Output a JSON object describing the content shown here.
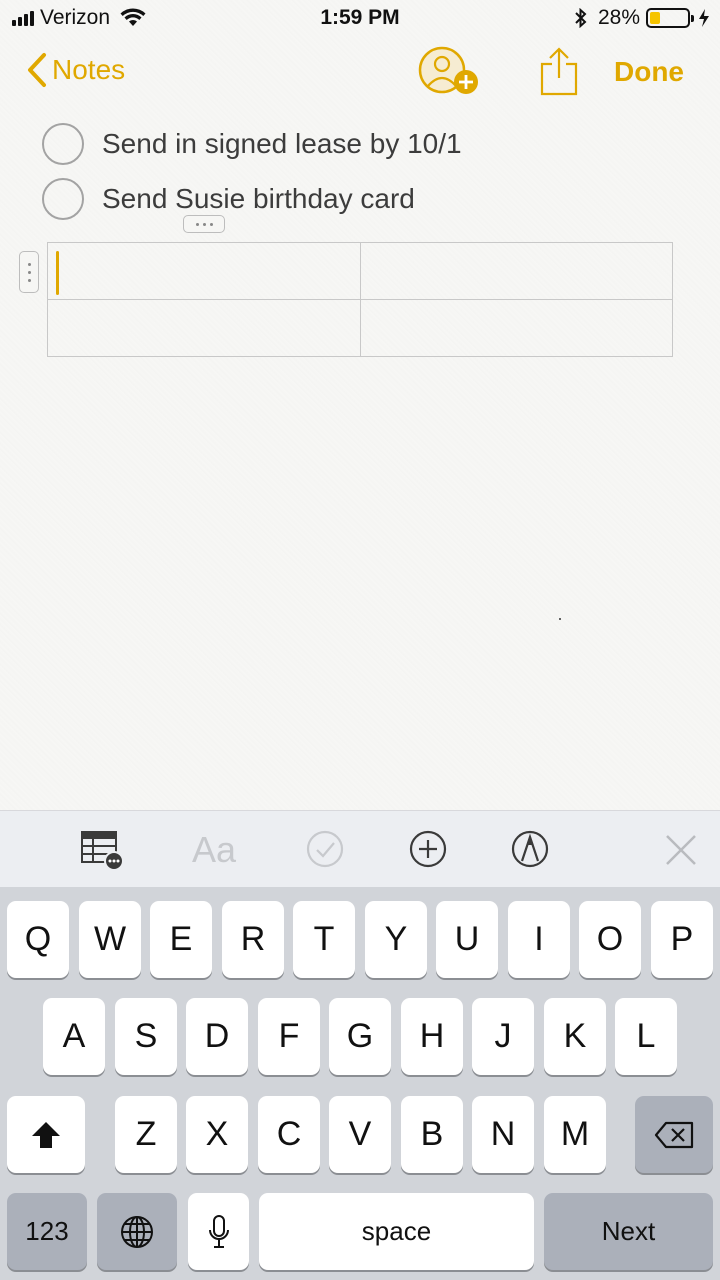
{
  "status_bar": {
    "carrier": "Verizon",
    "time": "1:59 PM",
    "battery_percent": "28%",
    "battery_level": 0.28,
    "battery_color": "#f5c400"
  },
  "nav": {
    "back_label": "Notes",
    "done_label": "Done",
    "accent_color": "#e0a800",
    "icons": [
      "chevron-left-icon",
      "add-people-icon",
      "share-icon"
    ]
  },
  "checklist": [
    {
      "text": "Send in signed lease by 10/1",
      "checked": false
    },
    {
      "text": "Send Susie birthday card",
      "checked": false
    }
  ],
  "table": {
    "rows": 2,
    "cols": 2,
    "cells": [
      [
        "",
        ""
      ],
      [
        "",
        ""
      ]
    ],
    "active_cell": [
      0,
      0
    ]
  },
  "toolbar": {
    "items": [
      "table-icon",
      "text-format-icon",
      "checklist-icon",
      "add-icon",
      "markup-icon",
      "close-icon"
    ],
    "text_format_label": "Aa"
  },
  "keyboard": {
    "row1": [
      "Q",
      "W",
      "E",
      "R",
      "T",
      "Y",
      "U",
      "I",
      "O",
      "P"
    ],
    "row2": [
      "A",
      "S",
      "D",
      "F",
      "G",
      "H",
      "J",
      "K",
      "L"
    ],
    "row3": [
      "Z",
      "X",
      "C",
      "V",
      "B",
      "N",
      "M"
    ],
    "numbers_label": "123",
    "space_label": "space",
    "next_label": "Next"
  }
}
